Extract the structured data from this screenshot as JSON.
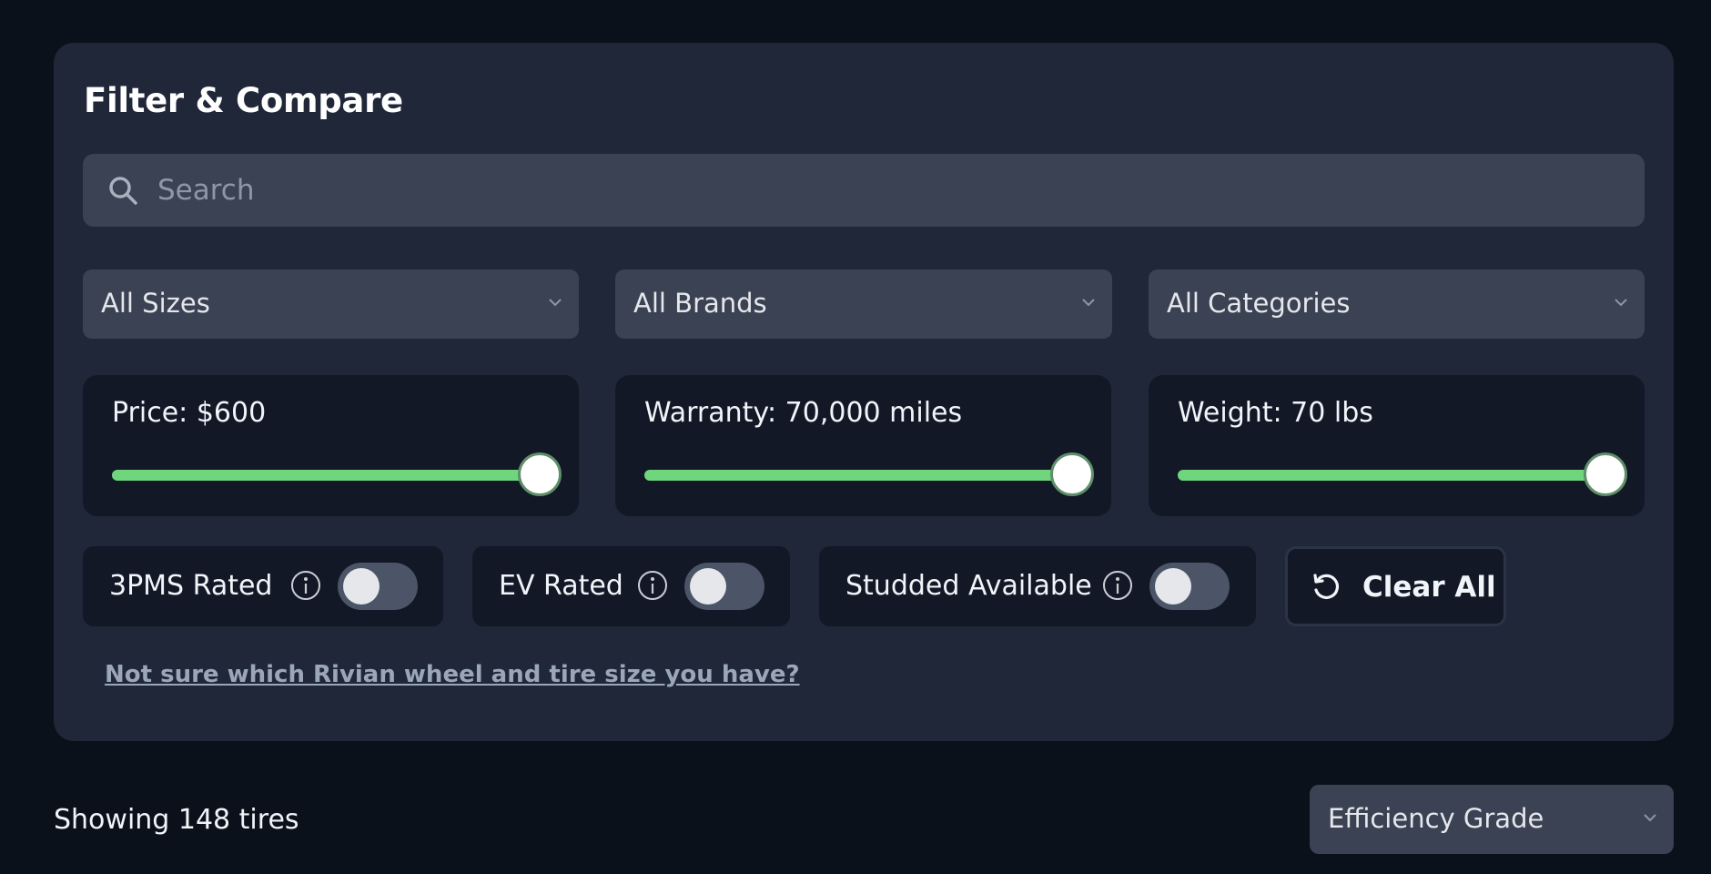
{
  "filters": {
    "title": "Filter & Compare",
    "search": {
      "placeholder": "Search",
      "value": ""
    },
    "selects": {
      "size": "All Sizes",
      "brand": "All Brands",
      "category": "All Categories"
    },
    "sliders": {
      "price": {
        "label": "Price: $600",
        "fill_percent": 100
      },
      "warranty": {
        "label": "Warranty: 70,000 miles",
        "fill_percent": 100
      },
      "weight": {
        "label": "Weight: 70 lbs",
        "fill_percent": 100
      }
    },
    "toggles": {
      "three_pms": {
        "label": "3PMS Rated",
        "on": false
      },
      "ev": {
        "label": "EV Rated",
        "on": false
      },
      "studded": {
        "label": "Studded Available",
        "on": false
      }
    },
    "clear_all_label": "Clear All",
    "help_link": "Not sure which Rivian wheel and tire size you have?"
  },
  "results": {
    "count_text": "Showing 148 tires",
    "sort": "Efficiency Grade"
  },
  "colors": {
    "page_bg": "#0b111b",
    "panel_bg": "#1f2738",
    "slider_fill": "#6fd67e"
  },
  "icons": {
    "search": "search-icon",
    "chevron": "chevron-down-icon",
    "info": "info-icon",
    "reset": "reset-icon"
  }
}
